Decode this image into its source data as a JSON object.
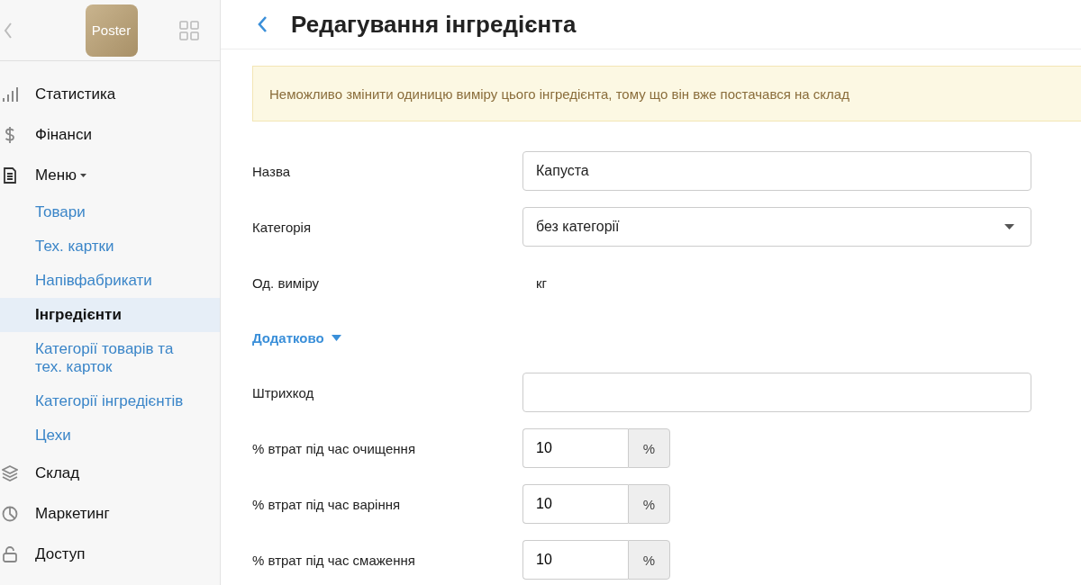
{
  "sidebar": {
    "logo": "Poster",
    "items": [
      {
        "label": "Статистика",
        "kind": "stats",
        "selected": false
      },
      {
        "label": "Фінанси",
        "kind": "dollar",
        "selected": false
      },
      {
        "label": "Меню",
        "kind": "doc",
        "selected": false,
        "expanded": true,
        "children": [
          {
            "label": "Товари",
            "selected": false
          },
          {
            "label": "Тех. картки",
            "selected": false
          },
          {
            "label": "Напівфабрикати",
            "selected": false
          },
          {
            "label": "Інгредієнти",
            "selected": true
          },
          {
            "label": "Категорії товарів та тех. карток",
            "selected": false
          },
          {
            "label": "Категорії інгредієнтів",
            "selected": false
          },
          {
            "label": "Цехи",
            "selected": false
          }
        ]
      },
      {
        "label": "Склад",
        "kind": "layers",
        "selected": false
      },
      {
        "label": "Маркетинг",
        "kind": "pie",
        "selected": false
      },
      {
        "label": "Доступ",
        "kind": "lock",
        "selected": false
      }
    ]
  },
  "page": {
    "title": "Редагування інгредієнта"
  },
  "alert": "Неможливо змінити одиницю виміру цього інгредієнта, тому що він вже постачався на склад",
  "fields": [
    {
      "kind": "text",
      "label": "Назва",
      "value": "Капуста"
    },
    {
      "kind": "select",
      "label": "Категорія",
      "value": "без категорії"
    },
    {
      "kind": "static",
      "label": "Од. виміру",
      "value": "кг"
    },
    {
      "kind": "toggle",
      "label": "Додатково",
      "expanded": true
    },
    {
      "kind": "text",
      "label": "Штрихкод"
    },
    {
      "kind": "addon",
      "label": "% втрат під час очищення",
      "value": "10",
      "addon": "%"
    },
    {
      "kind": "addon",
      "label": "% втрат під час варіння",
      "value": "10",
      "addon": "%"
    },
    {
      "kind": "addon",
      "label": "% втрат під час смаження",
      "value": "10",
      "addon": "%"
    }
  ]
}
